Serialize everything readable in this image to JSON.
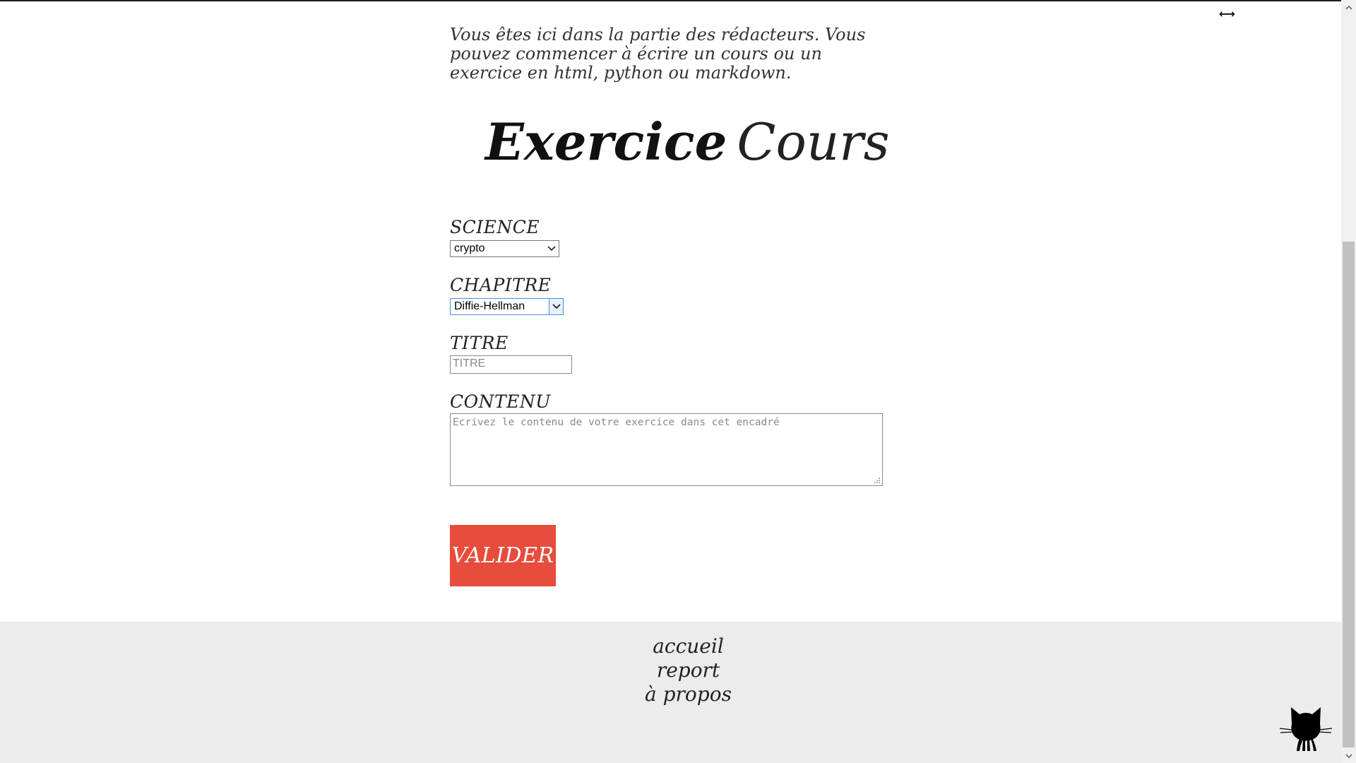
{
  "intro": "Vous êtes ici dans la partie des rédacteurs. Vous pouvez commencer à écrire un cours ou un exercice en html, python ou markdown.",
  "mode": {
    "exercice_label": "Exercice",
    "cours_label": "Cours"
  },
  "form": {
    "science_label": "SCIENCE",
    "science_value": "crypto",
    "chapitre_label": "CHAPITRE",
    "chapitre_value": "Diffie-Hellman",
    "titre_label": "TITRE",
    "titre_placeholder": "TITRE",
    "contenu_label": "CONTENU",
    "contenu_placeholder": "Ecrivez le contenu de votre exercice dans cet encadré",
    "submit_label": "VALIDER"
  },
  "footer": {
    "links": [
      "accueil",
      "report",
      "à propos"
    ]
  },
  "colors": {
    "accent": "#e74c3c",
    "footer_bg": "#ececec"
  },
  "icons": {
    "resize": "horizontal-resize-icon",
    "github": "github-octocat-icon"
  }
}
